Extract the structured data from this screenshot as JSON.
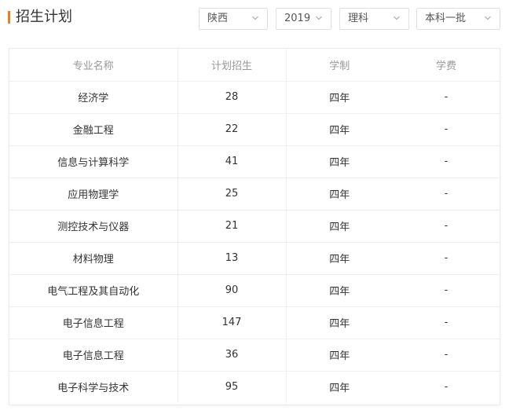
{
  "header": {
    "title": "招生计划",
    "filters": {
      "province": "陕西",
      "year": "2019",
      "subject": "理科",
      "batch": "本科一批"
    }
  },
  "colors": {
    "accent": "#f07c1c",
    "header_text": "#999999",
    "body_text": "#333333",
    "border": "#efefef"
  },
  "table": {
    "columns": [
      "专业名称",
      "计划招生",
      "学制",
      "学费"
    ],
    "rows": [
      {
        "major": "经济学",
        "plan": "28",
        "duration": "四年",
        "fee": "-"
      },
      {
        "major": "金融工程",
        "plan": "22",
        "duration": "四年",
        "fee": "-"
      },
      {
        "major": "信息与计算科学",
        "plan": "41",
        "duration": "四年",
        "fee": "-"
      },
      {
        "major": "应用物理学",
        "plan": "25",
        "duration": "四年",
        "fee": "-"
      },
      {
        "major": "测控技术与仪器",
        "plan": "21",
        "duration": "四年",
        "fee": "-"
      },
      {
        "major": "材料物理",
        "plan": "13",
        "duration": "四年",
        "fee": "-"
      },
      {
        "major": "电气工程及其自动化",
        "plan": "90",
        "duration": "四年",
        "fee": "-"
      },
      {
        "major": "电子信息工程",
        "plan": "147",
        "duration": "四年",
        "fee": "-"
      },
      {
        "major": "电子信息工程",
        "plan": "36",
        "duration": "四年",
        "fee": "-"
      },
      {
        "major": "电子科学与技术",
        "plan": "95",
        "duration": "四年",
        "fee": "-"
      }
    ]
  }
}
